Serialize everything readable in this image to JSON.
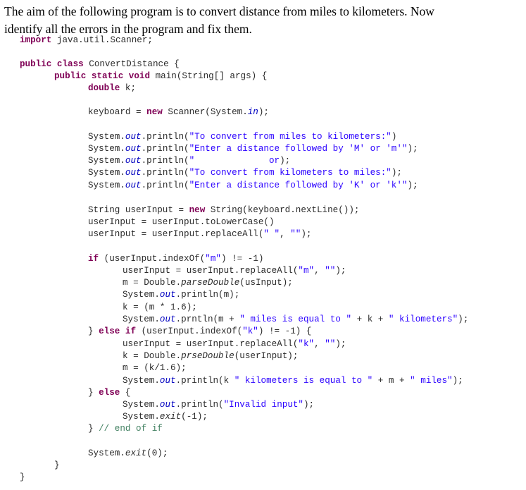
{
  "intro": {
    "line1": "The aim of the following program is to convert distance from miles to kilometers. Now",
    "line2": "identify all the errors in the program and fix them."
  },
  "colors": {
    "keyword": "#7f0055",
    "string": "#2a00ff",
    "field": "#0000c0",
    "comment": "#3f7f5f",
    "text": "#2a2a2a"
  },
  "code": {
    "import": {
      "kw": "import",
      "rest": " java.util.Scanner;"
    },
    "class_decl": {
      "kw": "public class",
      "rest": " ConvertDistance {"
    },
    "main_decl": {
      "kw": "public static void",
      "rest": " main(String[] args) {"
    },
    "var_decl": {
      "kw": "double",
      "rest": " k;"
    },
    "keyboard": {
      "a": "keyboard = ",
      "kw": "new",
      "b": " Scanner(System.",
      "fld": "in",
      "c": ");"
    },
    "prints": [
      {
        "a": "System.",
        "fld": "out",
        "b": ".println(",
        "str": "\"To convert from miles to kilometers:\"",
        "c": ")"
      },
      {
        "a": "System.",
        "fld": "out",
        "b": ".println(",
        "str": "\"Enter a distance followed by 'M' or 'm'\"",
        "c": ");"
      },
      {
        "a": "System.",
        "fld": "out",
        "b": ".println(",
        "str": "\"              or",
        "c": ");"
      },
      {
        "a": "System.",
        "fld": "out",
        "b": ".println(",
        "str": "\"To convert from kilometers to miles:\"",
        "c": ");"
      },
      {
        "a": "System.",
        "fld": "out",
        "b": ".println(",
        "str": "\"Enter a distance followed by 'K' or 'k'\"",
        "c": ");"
      }
    ],
    "input1": {
      "a": "String userInput = ",
      "kw": "new",
      "b": " String(keyboard.nextLine());"
    },
    "input2": "userInput = userInput.toLowerCase()",
    "input3": {
      "a": "userInput = userInput.replaceAll(",
      "s1": "\" \"",
      "m": ", ",
      "s2": "\"\"",
      "c": ");"
    },
    "if_line": {
      "kw": "if",
      "a": " (userInput.indexOf(",
      "s": "\"m\"",
      "c": ") != -1)"
    },
    "m_replace": {
      "a": "userInput = userInput.replaceAll(",
      "s1": "\"m\"",
      "m": ", ",
      "s2": "\"\"",
      "c": ");"
    },
    "m_parse": {
      "a": "m = Double.",
      "itl": "parseDouble",
      "c": "(usInput);"
    },
    "m_print": {
      "a": "System.",
      "fld": "out",
      "c": ".println(m);"
    },
    "k_calc": "k = (m * 1.6);",
    "m_result": {
      "a": "System.",
      "fld": "out",
      "b": ".prntln(m + ",
      "s1": "\" miles is equal to \"",
      "m": " + k + ",
      "s2": "\" kilometers\"",
      "c": ");"
    },
    "elseif_line": {
      "a": "} ",
      "kw": "else if",
      "b": " (userInput.indexOf(",
      "s": "\"k\"",
      "c": ") != -1) {"
    },
    "k_replace": {
      "a": "userInput = userInput.replaceAll(",
      "s1": "\"k\"",
      "m": ", ",
      "s2": "\"\"",
      "c": ");"
    },
    "k_parse": {
      "a": "k = Double.",
      "itl": "prseDouble",
      "c": "(userInput);"
    },
    "m_calc": "m = (k/1.6);",
    "k_result": {
      "a": "System.",
      "fld": "out",
      "b": ".println(k ",
      "s1": "\" kilometers is equal to \"",
      "m": " + m + ",
      "s2": "\" miles\"",
      "c": ");"
    },
    "else_line": {
      "a": "} ",
      "kw": "else",
      "c": " {"
    },
    "invalid": {
      "a": "System.",
      "fld": "out",
      "b": ".println(",
      "s": "\"Invalid input\"",
      "c": ");"
    },
    "exit_neg": {
      "a": "System.",
      "itl": "exit",
      "c": "(-1);"
    },
    "end_if": {
      "a": "} ",
      "cmt": "// end of if"
    },
    "exit_zero": {
      "a": "System.",
      "itl": "exit",
      "c": "(0);"
    },
    "close_main": "}",
    "close_class": "}"
  }
}
